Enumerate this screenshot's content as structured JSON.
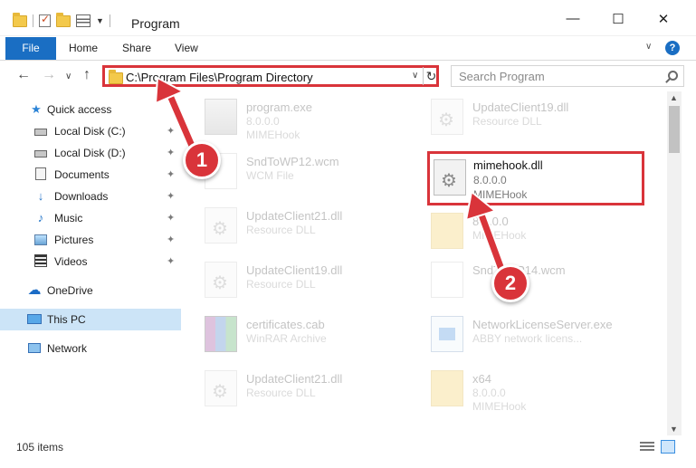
{
  "window": {
    "title": "Program",
    "minimize_glyph": "—",
    "maximize_glyph": "☐",
    "close_glyph": "✕"
  },
  "ribbon": {
    "tabs": [
      "File",
      "Home",
      "Share",
      "View"
    ],
    "expand_glyph": "∨",
    "help_glyph": "?"
  },
  "nav": {
    "back_glyph": "←",
    "forward_glyph": "→",
    "recent_glyph": "∨",
    "up_glyph": "↑"
  },
  "address": {
    "path": "C:\\Program Files\\Program Directory",
    "caret_glyph": "∨",
    "refresh_glyph": "↻"
  },
  "search": {
    "placeholder": "Search Program"
  },
  "sidebar": {
    "items": [
      {
        "label": "Quick access",
        "icon": "star-icon"
      },
      {
        "label": "Local Disk (C:)",
        "icon": "drive-icon",
        "pinned": true
      },
      {
        "label": "Local Disk (D:)",
        "icon": "drive-icon",
        "pinned": true
      },
      {
        "label": "Documents",
        "icon": "documents-icon",
        "pinned": true
      },
      {
        "label": "Downloads",
        "icon": "download-icon",
        "pinned": true
      },
      {
        "label": "Music",
        "icon": "music-icon",
        "pinned": true
      },
      {
        "label": "Pictures",
        "icon": "pictures-icon",
        "pinned": true
      },
      {
        "label": "Videos",
        "icon": "videos-icon",
        "pinned": true
      },
      {
        "label": "OneDrive",
        "icon": "cloud-icon"
      },
      {
        "label": "This PC",
        "icon": "computer-icon",
        "selected": true
      },
      {
        "label": "Network",
        "icon": "network-icon"
      }
    ],
    "pin_glyph": "📌"
  },
  "files": [
    {
      "name": "program.exe",
      "line2": "8.0.0.0",
      "line3": "MIMEHook",
      "icon": "exe-icon"
    },
    {
      "name": "UpdateClient19.dll",
      "line2": "Resource DLL",
      "line3": "",
      "icon": "dll-icon"
    },
    {
      "name": "SndToWP12.wcm",
      "line2": "WCM File",
      "line3": "",
      "icon": "file-icon"
    },
    {
      "name": "mimehook.dll",
      "line2": "8.0.0.0",
      "line3": "MIMEHook",
      "icon": "dll-icon",
      "highlighted": true
    },
    {
      "name": "UpdateClient21.dll",
      "line2": "Resource DLL",
      "line3": "",
      "icon": "dll-icon"
    },
    {
      "name": "8.0.0.0",
      "line2": "MIMEHook",
      "line3": "",
      "icon": "folder-icon"
    },
    {
      "name": "UpdateClient19.dll",
      "line2": "Resource DLL",
      "line3": "",
      "icon": "dll-icon"
    },
    {
      "name": "SndToWP14.wcm",
      "line2": "",
      "line3": "",
      "icon": "file-icon"
    },
    {
      "name": "certificates.cab",
      "line2": "WinRAR Archive",
      "line3": "",
      "icon": "rar-icon"
    },
    {
      "name": "NetworkLicenseServer.exe",
      "line2": "ABBY network licens...",
      "line3": "",
      "icon": "app-icon"
    },
    {
      "name": "UpdateClient21.dll",
      "line2": "Resource DLL",
      "line3": "",
      "icon": "dll-icon"
    },
    {
      "name": "x64",
      "line2": "8.0.0.0",
      "line3": "MIMEHook",
      "icon": "folder-icon"
    }
  ],
  "status": {
    "item_count": "105 items"
  },
  "annotations": {
    "step1": "1",
    "step2": "2",
    "color": "#d9343a"
  }
}
